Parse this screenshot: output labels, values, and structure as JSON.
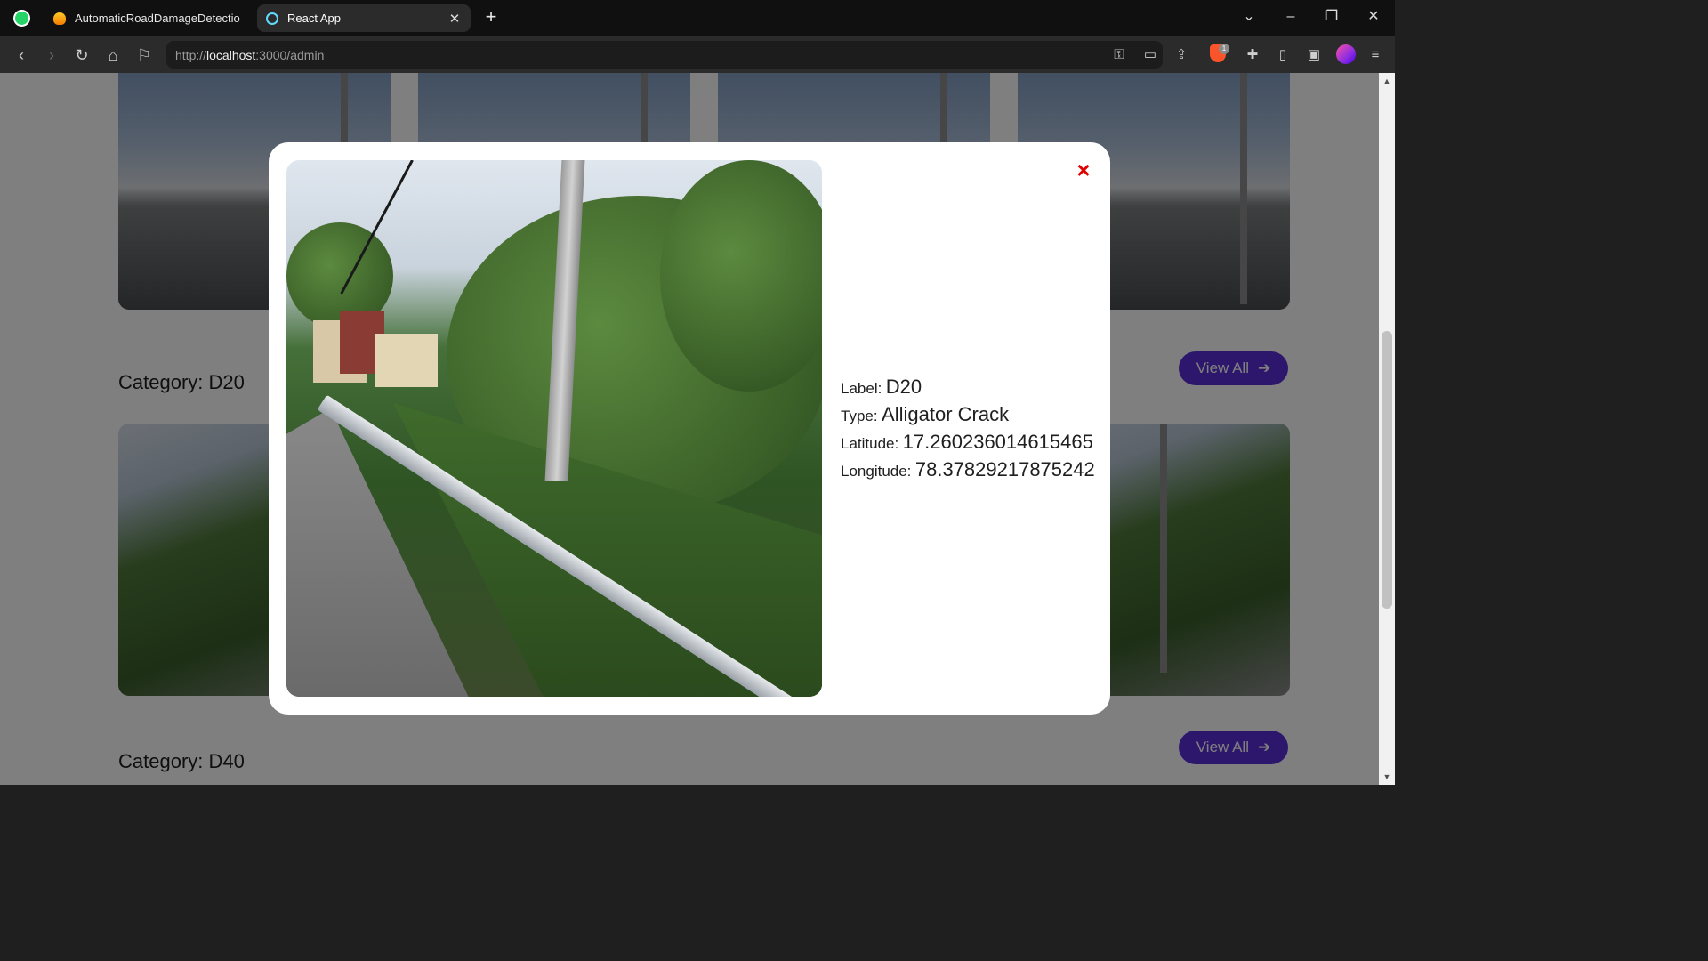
{
  "browser": {
    "tabs": [
      {
        "title": "AutomaticRoadDamageDetection - (",
        "icon": "firebase-icon",
        "active": false
      },
      {
        "title": "React App",
        "icon": "react-icon",
        "active": true
      }
    ],
    "new_tab": "+",
    "url_host": "localhost",
    "url_prefix": "http://",
    "url_suffix": ":3000/admin",
    "brave_badge": "1"
  },
  "page": {
    "categories": [
      {
        "label": "Category: D20",
        "view_all": "View All"
      },
      {
        "label": "Category: D40",
        "view_all": "View All"
      }
    ]
  },
  "modal": {
    "close": "×",
    "label_key": "Label:",
    "label_value": "D20",
    "type_key": "Type:",
    "type_value": "Alligator Crack",
    "lat_key": "Latitude:",
    "lat_value": "17.260236014615465",
    "lon_key": "Longitude:",
    "lon_value": "78.37829217875242"
  },
  "colors": {
    "accent": "#5b2ed8",
    "close": "#e00000"
  }
}
